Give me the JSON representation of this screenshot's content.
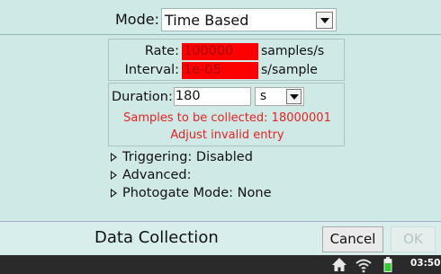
{
  "mode": {
    "label": "Mode:",
    "value": "Time Based"
  },
  "rate": {
    "label": "Rate:",
    "value": "100000",
    "unit": "samples/s"
  },
  "interval": {
    "label": "Interval:",
    "value": "1e-05",
    "unit": "s/sample"
  },
  "duration": {
    "label": "Duration:",
    "value": "180",
    "unit": "s"
  },
  "warnings": {
    "samples": "Samples to be collected: 18000001",
    "adjust": "Adjust invalid entry"
  },
  "sections": {
    "triggering": "Triggering: Disabled",
    "advanced": "Advanced:",
    "photogate": "Photogate Mode: None"
  },
  "footer": {
    "title": "Data Collection",
    "cancel": "Cancel",
    "ok": "OK"
  },
  "taskbar": {
    "clock": "03:50P",
    "icons": [
      "home-icon",
      "wifi-icon",
      "battery-icon"
    ]
  },
  "colors": {
    "background": "#cfe9e6",
    "invalid_field": "#ff0000",
    "warning_text": "#e42323",
    "taskbar": "#2a2a2a",
    "battery": "#33cc33"
  }
}
